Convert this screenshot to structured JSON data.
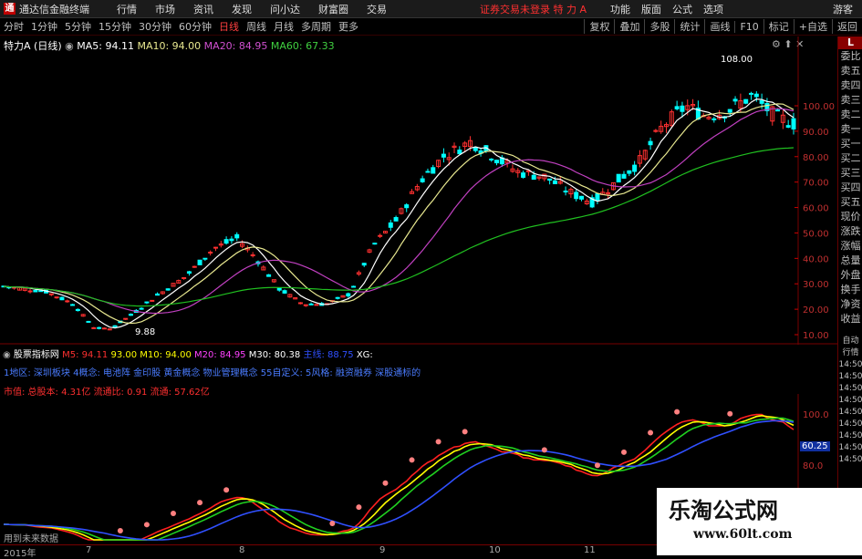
{
  "titlebar": {
    "app_title": "通达信金融终端",
    "menus": [
      "行情",
      "市场",
      "资讯",
      "发现",
      "问小达",
      "财富圈",
      "交易"
    ],
    "warning": "证券交易未登录",
    "stock": "特 力 A",
    "right_items": [
      "功能",
      "版面",
      "公式",
      "选项"
    ],
    "guest": "游客"
  },
  "periodbar": {
    "periods": [
      "分时",
      "1分钟",
      "5分钟",
      "15分钟",
      "30分钟",
      "60分钟",
      "日线",
      "周线",
      "月线",
      "多周期",
      "更多"
    ],
    "active": "日线",
    "tools": [
      "复权",
      "叠加",
      "多股",
      "统计",
      "画线",
      "F10",
      "标记",
      "+自选",
      "返回"
    ]
  },
  "main_chart": {
    "stock_label": "特力A",
    "period_label": "(日线)",
    "ma_items": [
      {
        "label": "MA5: 94.11",
        "color": "#ffffff"
      },
      {
        "label": "MA10: 94.00",
        "color": "#e8e890"
      },
      {
        "label": "MA20: 84.95",
        "color": "#d050d0"
      },
      {
        "label": "MA60: 67.33",
        "color": "#40d040"
      }
    ],
    "price_axis": [
      "100.00",
      "90.00",
      "80.00",
      "70.00",
      "60.00",
      "50.00",
      "40.00",
      "30.00",
      "20.00",
      "10.00"
    ],
    "high_label": "108.00",
    "low_label": "9.88",
    "colors": {
      "up": "#ff3030",
      "down": "#00ffff",
      "ma5": "#ffffff",
      "ma10": "#e8e890",
      "ma20": "#c040c0",
      "ma60": "#20c020"
    }
  },
  "indicator": {
    "title": "股票指标网",
    "values": [
      {
        "label": "M5: 94.11",
        "color": "#ff3030"
      },
      {
        "label": "93.00",
        "color": "#ffff00"
      },
      {
        "label": "M10: 94.00",
        "color": "#ffff00"
      },
      {
        "label": "M20: 84.95",
        "color": "#ff40ff"
      },
      {
        "label": "M30: 80.38",
        "color": "#ffffff"
      },
      {
        "label": "主线: 88.75",
        "color": "#3050ff"
      },
      {
        "label": "XG:",
        "color": "#ffffff"
      }
    ],
    "info_line": "1地区: 深圳板块    4概念: 电池阵 金印股 黄金概念 物业管理概念    55自定义:    5风格: 融资融券 深股通标的",
    "market_line": [
      {
        "label": "市值: 总股本: 4.31亿",
        "color": "#ff3030"
      },
      {
        "label": "流通比: 0.91",
        "color": "#ff3030"
      },
      {
        "label": "流通: 57.62亿",
        "color": "#ff3030"
      }
    ],
    "axis": [
      "100.0",
      "80.0",
      "60.0"
    ],
    "current": "60.25",
    "footer": "用到未来数据"
  },
  "time_axis": [
    "2015年",
    "7",
    "8",
    "9",
    "10",
    "11"
  ],
  "right_panel": [
    "委比",
    "卖五",
    "卖四",
    "卖三",
    "卖二",
    "卖一",
    "买一",
    "买二",
    "买三",
    "买四",
    "买五",
    "现价",
    "涨跌",
    "涨幅",
    "总量",
    "外盘",
    "换手",
    "净资",
    "收益"
  ],
  "right_panel_bottom": [
    "自动",
    "行情",
    "14:50",
    "14:50",
    "14:50",
    "14:50",
    "14:50",
    "14:50",
    "14:50",
    "14:50",
    "14:50"
  ],
  "watermark": {
    "line1": "乐淘公式网",
    "line2": "www.60lt.com"
  }
}
